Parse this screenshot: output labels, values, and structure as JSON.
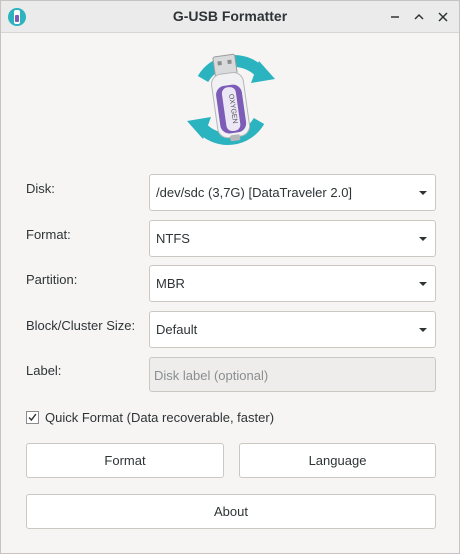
{
  "window": {
    "title": "G-USB Formatter",
    "icon": "usb-app-icon",
    "controls": [
      "minimize-icon",
      "maximize-icon",
      "close-icon"
    ]
  },
  "logo": {
    "icon": "usb-drive-refresh-logo",
    "brand_text": "OXYGEN"
  },
  "form": {
    "disk": {
      "label": "Disk:",
      "value": "/dev/sdc (3,7G) [DataTraveler 2.0]"
    },
    "format": {
      "label": "Format:",
      "value": "NTFS"
    },
    "partition": {
      "label": "Partition:",
      "value": "MBR"
    },
    "block_size": {
      "label": "Block/Cluster Size:",
      "value": "Default"
    },
    "disk_label": {
      "label": "Label:",
      "value": "",
      "placeholder": "Disk label (optional)"
    },
    "quick_format": {
      "label": "Quick Format (Data recoverable, faster)",
      "checked": true
    }
  },
  "buttons": {
    "format": "Format",
    "language": "Language",
    "about": "About"
  },
  "colors": {
    "teal": "#2bb3c0",
    "purple": "#7d5cb8",
    "window_bg": "#f6f5f4"
  }
}
